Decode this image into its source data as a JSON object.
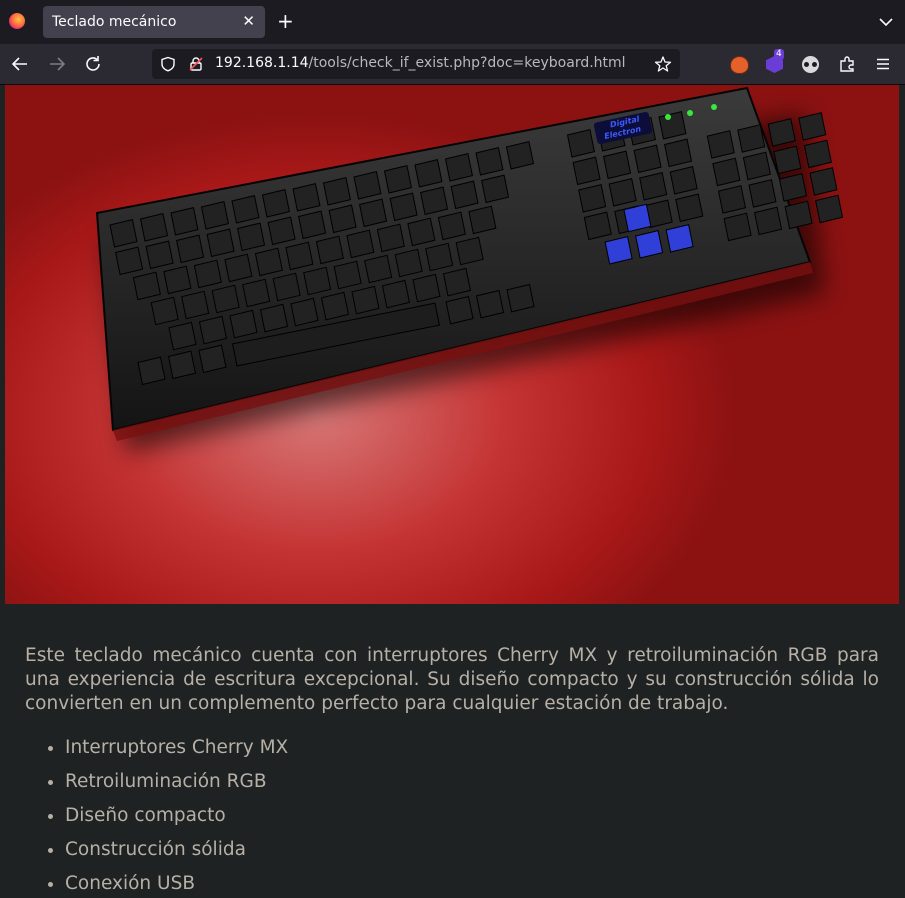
{
  "browser": {
    "tab_title": "Teclado mecánico",
    "url_host": "192.168.1.14",
    "url_path": "/tools/check_if_exist.php?doc=keyboard.html",
    "extension_badge": "4"
  },
  "image": {
    "brand_line1": "Digital",
    "brand_line2": "Electron"
  },
  "article": {
    "description": "Este teclado mecánico cuenta con interruptores Cherry MX y retroiluminación RGB para una experiencia de escritura excepcional. Su diseño compacto y su construcción sólida lo convierten en un complemento perfecto para cualquier estación de trabajo.",
    "features": [
      "Interruptores Cherry MX",
      "Retroiluminación RGB",
      "Diseño compacto",
      "Construcción sólida",
      "Conexión USB"
    ]
  },
  "colors": {
    "page_bg": "#1f2223",
    "text": "#b6b0a6",
    "hero_red": "#c53434",
    "arrow_key_blue": "#2f3fd8",
    "led_green": "#39e83a"
  }
}
